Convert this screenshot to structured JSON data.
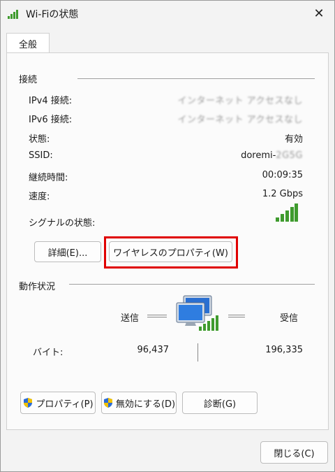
{
  "window": {
    "title": "Wi-Fiの状態",
    "close_glyph": "✕"
  },
  "tab": {
    "label": "全般"
  },
  "connection": {
    "heading": "接続",
    "rows": [
      {
        "label": "IPv4 接続:",
        "value": "インターネット アクセスなし"
      },
      {
        "label": "IPv6 接続:",
        "value": "インターネット アクセスなし"
      },
      {
        "label": "状態:",
        "value": "有効"
      },
      {
        "label": "SSID:",
        "value": "doremi-",
        "value_blurred": "2G5G"
      },
      {
        "label": "継続時間:",
        "value": "00:09:35"
      },
      {
        "label": "速度:",
        "value": "1.2 Gbps"
      },
      {
        "label": "シグナルの状態:"
      }
    ],
    "details_button": "詳細(E)...",
    "wireless_props_button": "ワイヤレスのプロパティ(W)"
  },
  "activity": {
    "heading": "動作状況",
    "sent_label": "送信",
    "received_label": "受信",
    "bytes_label": "バイト:",
    "bytes_sent": "96,437",
    "bytes_received": "196,335"
  },
  "actions": {
    "properties": "プロパティ(P)",
    "disable": "無効にする(D)",
    "diagnose": "診断(G)"
  },
  "footer": {
    "close": "閉じる(C)"
  },
  "colors": {
    "signal": "#3f9b2e",
    "highlight": "#e00000",
    "shield_blue": "#2b6cd6",
    "shield_yellow": "#f2c200"
  }
}
